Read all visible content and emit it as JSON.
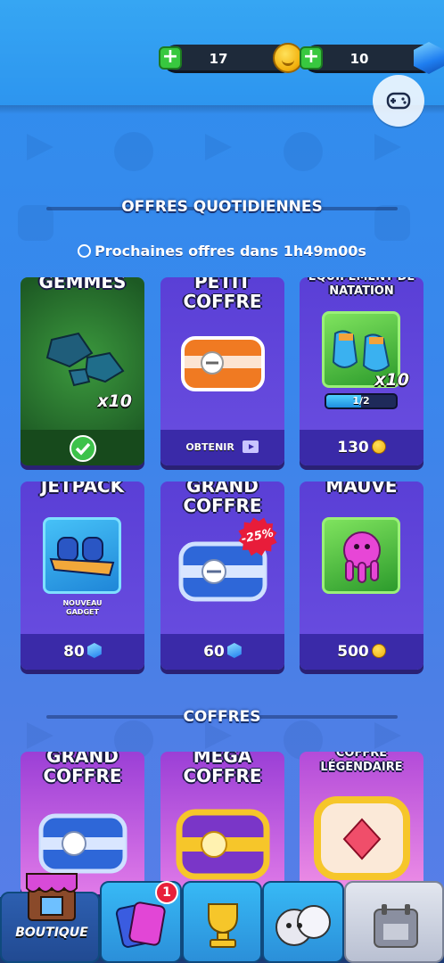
{
  "resources": {
    "coins": "17",
    "gems": "10"
  },
  "daily": {
    "title": "OFFRES QUOTIDIENNES",
    "timer": "Prochaines offres dans 1h49m00s"
  },
  "offers": [
    {
      "title": "GEMMES",
      "qty": "x10",
      "status": "claimed"
    },
    {
      "title": "PETIT COFFRE",
      "footer": "OBTENIR"
    },
    {
      "title": "ÉQUIPEMENT DE NATATION",
      "qty": "x10",
      "progress": "1/2",
      "progress_value": 0.5,
      "price": "130",
      "currency": "coin"
    },
    {
      "title": "JETPACK",
      "subtitle": "NOUVEAU GADGET",
      "price": "80",
      "currency": "gem"
    },
    {
      "title": "GRAND COFFRE",
      "discount": "-25%",
      "price": "60",
      "currency": "gem"
    },
    {
      "title": "MAUVE",
      "price": "500",
      "currency": "coin"
    }
  ],
  "chests": {
    "title": "COFFRES",
    "items": [
      {
        "title": "GRAND COFFRE"
      },
      {
        "title": "MÉGA COFFRE"
      },
      {
        "title": "COFFRE LÉGENDAIRE"
      }
    ]
  },
  "nav": {
    "shop_label": "BOUTIQUE",
    "cards_badge": "1"
  },
  "colors": {
    "accent": "#5a3fd6",
    "footer": "#3a2aa8",
    "green": "#38c83f",
    "badge": "#e8203a"
  }
}
